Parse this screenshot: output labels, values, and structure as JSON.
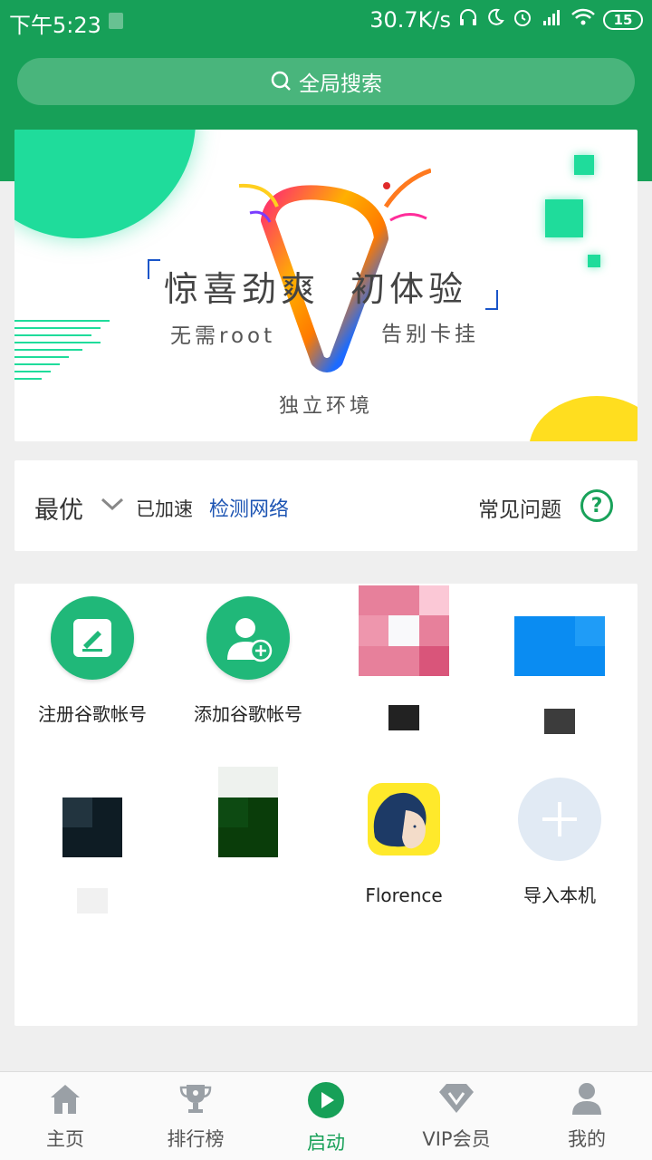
{
  "status_bar": {
    "time": "下午5:23",
    "speed": "30.7K/s",
    "battery": "15",
    "icons": [
      "headphones-icon",
      "moon-icon",
      "alarm-icon",
      "signal-icon",
      "wifi-icon",
      "battery-icon"
    ]
  },
  "search": {
    "label": "全局搜索",
    "icon": "search-icon"
  },
  "banner": {
    "title": "惊喜劲爽  初体验",
    "subtitle_left": "无需root",
    "subtitle_right": "告别卡挂",
    "bottom_text": "独立环境",
    "colors": {
      "mint": "#1fdc9b",
      "yellow": "#ffde1f"
    }
  },
  "accel": {
    "mode": "最优",
    "status": "已加速",
    "detect_link": "检测网络",
    "faq": "常见问题",
    "faq_icon": "?"
  },
  "apps": [
    {
      "label": "注册谷歌帐号",
      "icon": "edit-icon"
    },
    {
      "label": "添加谷歌帐号",
      "icon": "add-user-icon"
    },
    {
      "label": "",
      "icon": "blurred-app-icon"
    },
    {
      "label": "",
      "icon": "blurred-app-icon"
    },
    {
      "label": "",
      "icon": "blurred-app-icon"
    },
    {
      "label": "",
      "icon": "blurred-app-icon"
    },
    {
      "label": "Florence",
      "icon": "florence-icon"
    },
    {
      "label": "导入本机",
      "icon": "plus-icon"
    }
  ],
  "nav": [
    {
      "label": "主页",
      "icon": "home-icon"
    },
    {
      "label": "排行榜",
      "icon": "trophy-icon"
    },
    {
      "label": "启动",
      "icon": "play-icon",
      "active": true
    },
    {
      "label": "VIP会员",
      "icon": "diamond-icon"
    },
    {
      "label": "我的",
      "icon": "user-icon"
    }
  ],
  "colors": {
    "brand": "#17a058",
    "link": "#1e55b3"
  }
}
